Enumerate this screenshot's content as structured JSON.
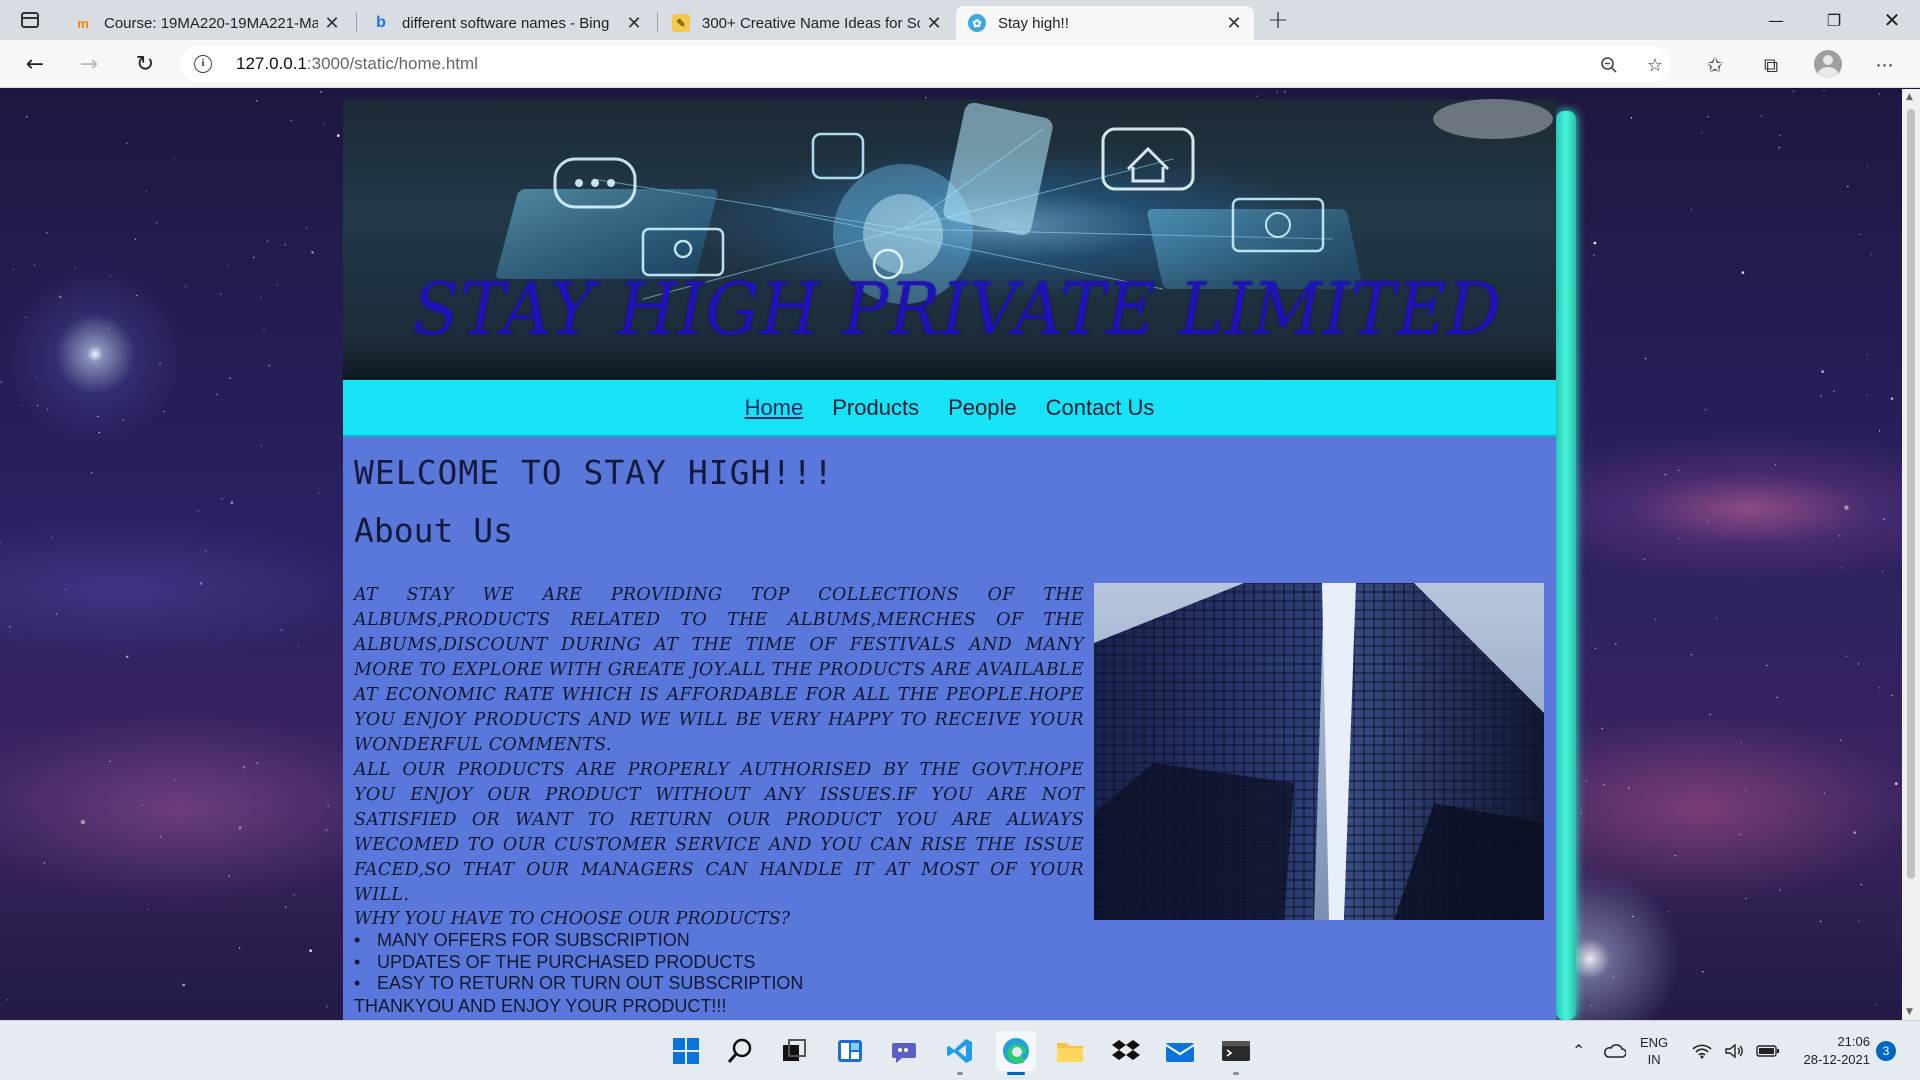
{
  "browser": {
    "tabs": [
      {
        "title": "Course: 19MA220-19MA221-Ma",
        "favicon": "moodle-icon",
        "active": false
      },
      {
        "title": "different software names - Bing",
        "favicon": "bing-icon",
        "active": false
      },
      {
        "title": "300+ Creative Name Ideas for Sc",
        "favicon": "site-icon",
        "active": false
      },
      {
        "title": "Stay high!!",
        "favicon": "page-icon",
        "active": true
      }
    ],
    "url_host": "127.0.0.1",
    "url_rest": ":3000/static/home.html"
  },
  "page": {
    "banner_title": "STAY HIGH PRIVATE LIMITED",
    "nav": [
      {
        "label": "Home",
        "current": true
      },
      {
        "label": "Products",
        "current": false
      },
      {
        "label": "People",
        "current": false
      },
      {
        "label": "Contact Us",
        "current": false
      }
    ],
    "welcome": "WELCOME TO STAY HIGH!!!",
    "about_heading": "About Us",
    "about_p1": "AT STAY WE ARE PROVIDING TOP COLLECTIONS OF THE ALBUMS,PRODUCTS RELATED TO THE ALBUMS,MERCHES OF THE ALBUMS,DISCOUNT DURING AT THE TIME OF FESTIVALS AND MANY MORE TO EXPLORE WITH GREATE JOY.ALL THE PRODUCTS ARE AVAILABLE AT ECONOMIC RATE WHICH IS AFFORDABLE FOR ALL THE PEOPLE.HOPE YOU ENJOY PRODUCTS AND WE WILL BE VERY HAPPY TO RECEIVE YOUR WONDERFUL COMMENTS.",
    "about_p2": "ALL OUR PRODUCTS ARE PROPERLY AUTHORISED BY THE GOVT.HOPE YOU ENJOY OUR PRODUCT WITHOUT ANY ISSUES.IF YOU ARE NOT SATISFIED OR WANT TO RETURN OUR PRODUCT YOU ARE ALWAYS WECOMED TO OUR CUSTOMER SERVICE AND YOU CAN RISE THE ISSUE FACED,SO THAT OUR MANAGERS CAN HANDLE IT AT MOST OF YOUR WILL.",
    "why_heading": "WHY YOU HAVE TO CHOOSE OUR PRODUCTS?",
    "reasons": [
      "MANY OFFERS FOR SUBSCRIPTION",
      "UPDATES OF THE PURCHASED PRODUCTS",
      "EASY TO RETURN OR TURN OUT SUBSCRIPTION"
    ],
    "thanks": "THANKYOU AND ENJOY YOUR PRODUCT!!!",
    "colors": {
      "nav_bg": "#16e3f5",
      "content_bg": "#5a78dc",
      "banner_title": "#1e12b8",
      "glow": "#48f5d8"
    }
  },
  "taskbar": {
    "apps": [
      "start-icon",
      "search-icon",
      "task-view-icon",
      "widgets-icon",
      "teams-chat-icon",
      "vscode-icon",
      "edge-icon",
      "file-explorer-icon",
      "dropbox-icon",
      "mail-icon",
      "terminal-icon"
    ],
    "lang_top": "ENG",
    "lang_bottom": "IN",
    "time": "21:06",
    "date": "28-12-2021",
    "notifications": "3"
  }
}
